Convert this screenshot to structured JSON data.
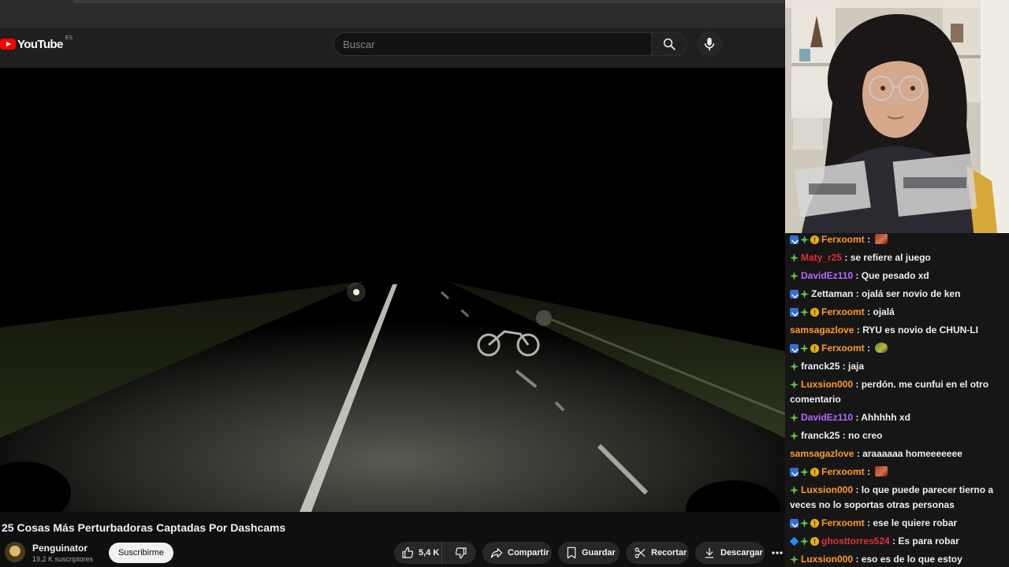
{
  "header": {
    "logo_text": "YouTube",
    "logo_region": "ES",
    "search_placeholder": "Buscar"
  },
  "video": {
    "title": "25 Cosas Más Perturbadoras Captadas Por Dashcams",
    "channel_name": "Penguinator",
    "channel_subs": "19,2 K suscriptores",
    "subscribe_label": "Suscribirme",
    "like_count": "5,4 K",
    "share_label": "Compartir",
    "save_label": "Guardar",
    "clip_label": "Recortar",
    "download_label": "Descargar"
  },
  "colors": {
    "user_orange": "#ff9b2e",
    "user_purple": "#b36cff",
    "user_green": "#35d46c",
    "user_red": "#e0303c",
    "user_white": "#efeff1"
  },
  "chat": {
    "messages": [
      {
        "user": "Ferxoomt",
        "badges": [
          "prime",
          "star",
          "coin"
        ],
        "color": "#ff9b2e",
        "text": "",
        "emote": "red"
      },
      {
        "user": "Maty_r25",
        "badges": [
          "star"
        ],
        "color": "#e0303c",
        "text": "se refiere al juego"
      },
      {
        "user": "DavidEz110",
        "badges": [
          "star"
        ],
        "color": "#b36cff",
        "text": "Que pesado xd"
      },
      {
        "user": "Zettaman",
        "badges": [
          "prime",
          "star"
        ],
        "color": "#efeff1",
        "text": "ojalá ser novio de ken"
      },
      {
        "user": "Ferxoomt",
        "badges": [
          "prime",
          "star",
          "coin"
        ],
        "color": "#ff9b2e",
        "text": "ojalá"
      },
      {
        "user": "samsagazlove",
        "badges": [],
        "color": "#ff9b2e",
        "text": "RYU es novio de CHUN-LI"
      },
      {
        "user": "Ferxoomt",
        "badges": [
          "prime",
          "star",
          "coin"
        ],
        "color": "#ff9b2e",
        "text": "",
        "emote": "green"
      },
      {
        "user": "franck25",
        "badges": [
          "star"
        ],
        "color": "#efeff1",
        "text": "jaja"
      },
      {
        "user": "Luxsion000",
        "badges": [
          "star"
        ],
        "color": "#ff9b2e",
        "text": "perdón. me cunfui en el otro comentario"
      },
      {
        "user": "DavidEz110",
        "badges": [
          "star"
        ],
        "color": "#b36cff",
        "text": "Ahhhhh xd"
      },
      {
        "user": "franck25",
        "badges": [
          "star"
        ],
        "color": "#efeff1",
        "text": "no creo"
      },
      {
        "user": "samsagazlove",
        "badges": [],
        "color": "#ff9b2e",
        "text": "araaaaaa homeeeeeee"
      },
      {
        "user": "Ferxoomt",
        "badges": [
          "prime",
          "star",
          "coin"
        ],
        "color": "#ff9b2e",
        "text": "",
        "emote": "red"
      },
      {
        "user": "Luxsion000",
        "badges": [
          "star"
        ],
        "color": "#ff9b2e",
        "text": "lo que puede parecer tierno a veces no lo soportas otras personas"
      },
      {
        "user": "Ferxoomt",
        "badges": [
          "prime",
          "star",
          "coin"
        ],
        "color": "#ff9b2e",
        "text": "ese le quiere robar"
      },
      {
        "user": "ghosttorres524",
        "badges": [
          "cube",
          "star",
          "coin"
        ],
        "color": "#e0303c",
        "text": "Es para robar"
      },
      {
        "user": "Luxsion000",
        "badges": [
          "star"
        ],
        "color": "#ff9b2e",
        "text": "eso es de lo que estoy hablando"
      }
    ]
  }
}
